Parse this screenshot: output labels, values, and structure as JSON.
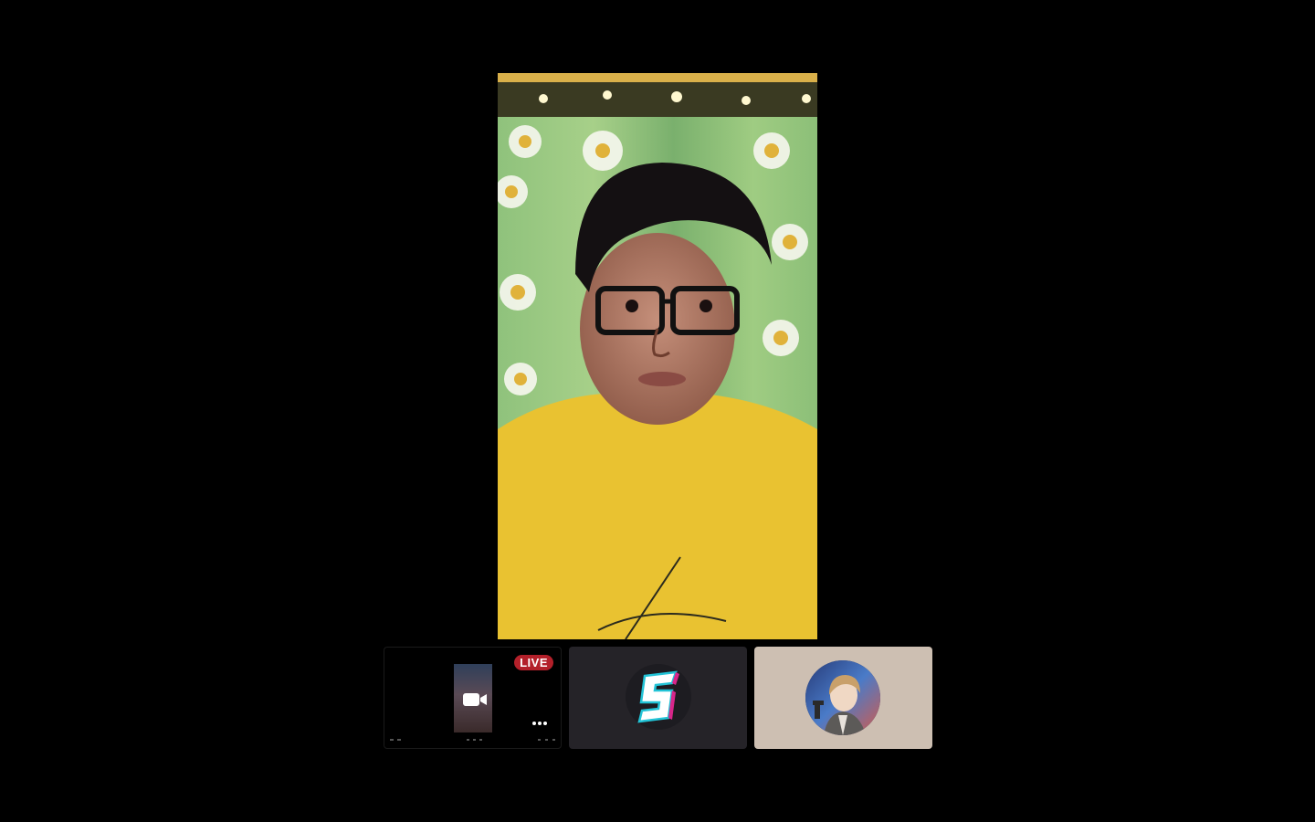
{
  "call": {
    "main_participant": "participant-1",
    "thumbnails": [
      {
        "id": "self-preview",
        "badge": "LIVE",
        "kind": "camera-preview"
      },
      {
        "id": "participant-s",
        "kind": "logo"
      },
      {
        "id": "participant-avatar",
        "kind": "avatar"
      }
    ]
  },
  "icons": {
    "camera": "video-camera-icon",
    "more": "more-options-icon",
    "logo": "s-logo-icon"
  },
  "colors": {
    "background": "#000000",
    "live_badge": "#b3202a",
    "tile_dark": "#252328",
    "tile_light": "#cdbfb2"
  }
}
